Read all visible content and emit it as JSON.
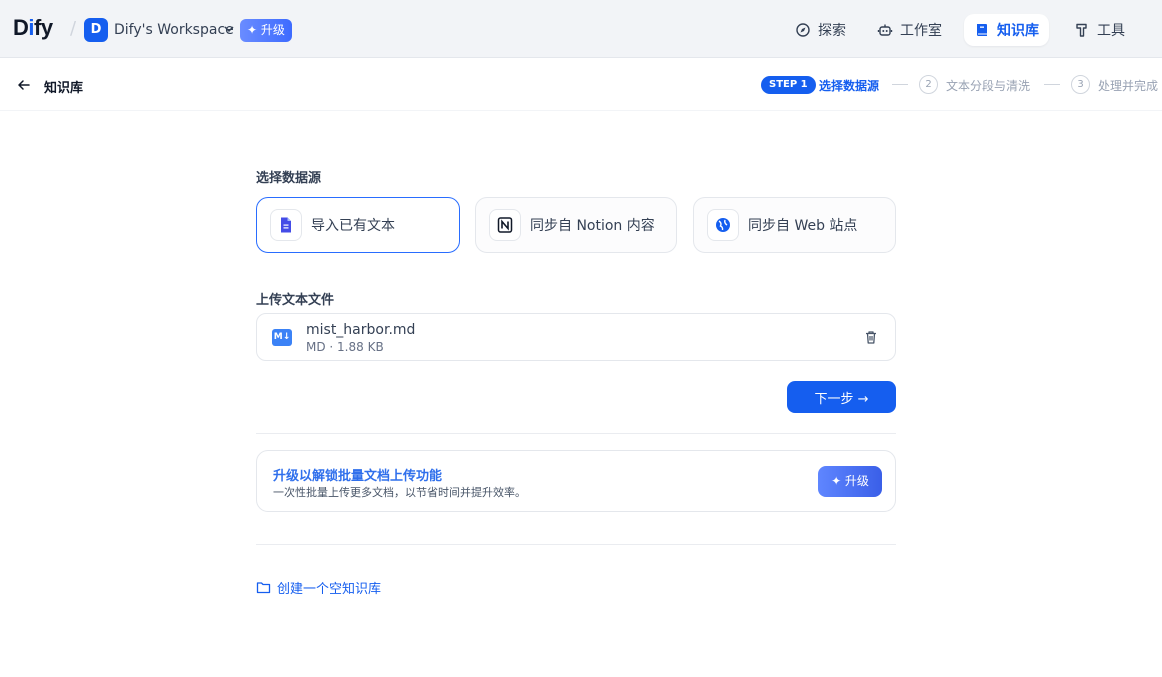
{
  "header": {
    "logo_prefix": "D",
    "logo_i": "i",
    "logo_suffix": "fy",
    "workspace_initial": "D",
    "workspace_name": "Dify's Workspace",
    "upgrade_label": "✦ 升级",
    "nav": [
      {
        "label": "探索",
        "icon": "compass-icon",
        "active": false
      },
      {
        "label": "工作室",
        "icon": "robot-icon",
        "active": false
      },
      {
        "label": "知识库",
        "icon": "book-icon",
        "active": true
      },
      {
        "label": "工具",
        "icon": "hammer-icon",
        "active": false
      }
    ]
  },
  "subheader": {
    "title": "知识库",
    "steps": [
      {
        "badge": "STEP 1",
        "label": "选择数据源",
        "active": true
      },
      {
        "number": "2",
        "label": "文本分段与清洗",
        "active": false
      },
      {
        "number": "3",
        "label": "处理并完成",
        "active": false
      }
    ]
  },
  "main": {
    "data_source_title": "选择数据源",
    "sources": [
      {
        "label": "导入已有文本",
        "icon": "file-icon",
        "selected": true
      },
      {
        "label": "同步自 Notion 内容",
        "icon": "notion-icon",
        "selected": false
      },
      {
        "label": "同步自 Web 站点",
        "icon": "globe-icon",
        "selected": false
      }
    ],
    "upload_title": "上传文本文件",
    "file": {
      "badge": "M↓",
      "name": "mist_harbor.md",
      "meta": "MD · 1.88 KB"
    },
    "next_label": "下一步 →",
    "upgrade_card": {
      "title": "升级以解锁批量文档上传功能",
      "description": "一次性批量上传更多文档，以节省时间并提升效率。",
      "button_label": "✦ 升级"
    },
    "create_empty_label": "创建一个空知识库"
  },
  "colors": {
    "accent": "#155eef",
    "selected_border": "#296dff",
    "header_bg": "#f2f4f7"
  }
}
